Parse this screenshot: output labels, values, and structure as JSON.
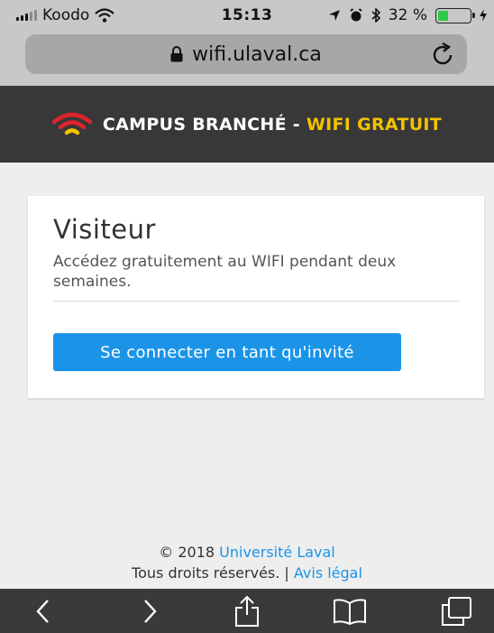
{
  "status_bar": {
    "carrier": "Koodo",
    "time": "15:13",
    "battery_percent": "32 %",
    "battery_level": 0.32
  },
  "browser": {
    "url": "wifi.ulaval.ca",
    "icons": [
      "lock-icon",
      "reload-icon",
      "back-icon",
      "forward-icon",
      "share-icon",
      "bookmarks-icon",
      "tabs-icon"
    ]
  },
  "header": {
    "brand_main": "CAMPUS BRANCHÉ",
    "brand_sep": " - ",
    "brand_accent": "WIFI GRATUIT",
    "logo": "wifi-logo-icon"
  },
  "card": {
    "title": "Visiteur",
    "description": "Accédez gratuitement au WIFI pendant deux semaines.",
    "button_label": "Se connecter en tant qu'invité"
  },
  "footer": {
    "copyright_prefix": "© 2018 ",
    "university_link": "Université Laval",
    "rights": "Tous droits réservés. | ",
    "legal_link": "Avis légal"
  },
  "colors": {
    "header_bg": "#383838",
    "accent_yellow": "#f2c200",
    "button_blue": "#1b94e8",
    "logo_red": "#e0242b"
  }
}
